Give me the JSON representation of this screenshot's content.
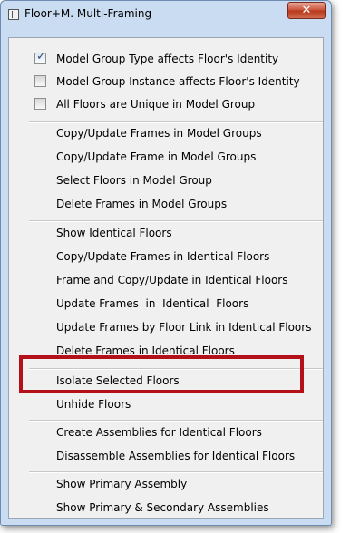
{
  "window": {
    "title": "Floor+M. Multi-Framing",
    "close_label": "✕"
  },
  "checkboxes": [
    {
      "label": "Model Group Type affects Floor's Identity",
      "checked": true
    },
    {
      "label": "Model Group Instance affects Floor's Identity",
      "checked": false
    },
    {
      "label": "All Floors are Unique in Model Group",
      "checked": false
    }
  ],
  "groups": {
    "model_groups": [
      "Copy/Update Frames in Model Groups",
      "Copy/Update Frame in Model Groups",
      "Select Floors in Model Group",
      "Delete Frames in Model Groups"
    ],
    "identical": [
      "Show Identical Floors",
      "Copy/Update Frames in Identical Floors",
      "Frame and Copy/Update in Identical Floors",
      "Update Frames  in  Identical  Floors",
      "Update Frames by Floor Link in Identical Floors",
      "Delete Frames in Identical Floors"
    ],
    "isolate": [
      "Isolate Selected Floors",
      "Unhide Floors"
    ],
    "assemblies": [
      "Create Assemblies for Identical Floors",
      "Disassemble Assemblies for Identical Floors"
    ],
    "primary": [
      "Show Primary Assembly",
      "Show Primary & Secondary Assemblies"
    ]
  },
  "highlighted_item": "Copy/Update Frames in Identical Floors",
  "colors": {
    "highlight_border": "#b4101a",
    "title_bar": "#c9dcf1",
    "menu_bg": "#f0f0f0"
  }
}
